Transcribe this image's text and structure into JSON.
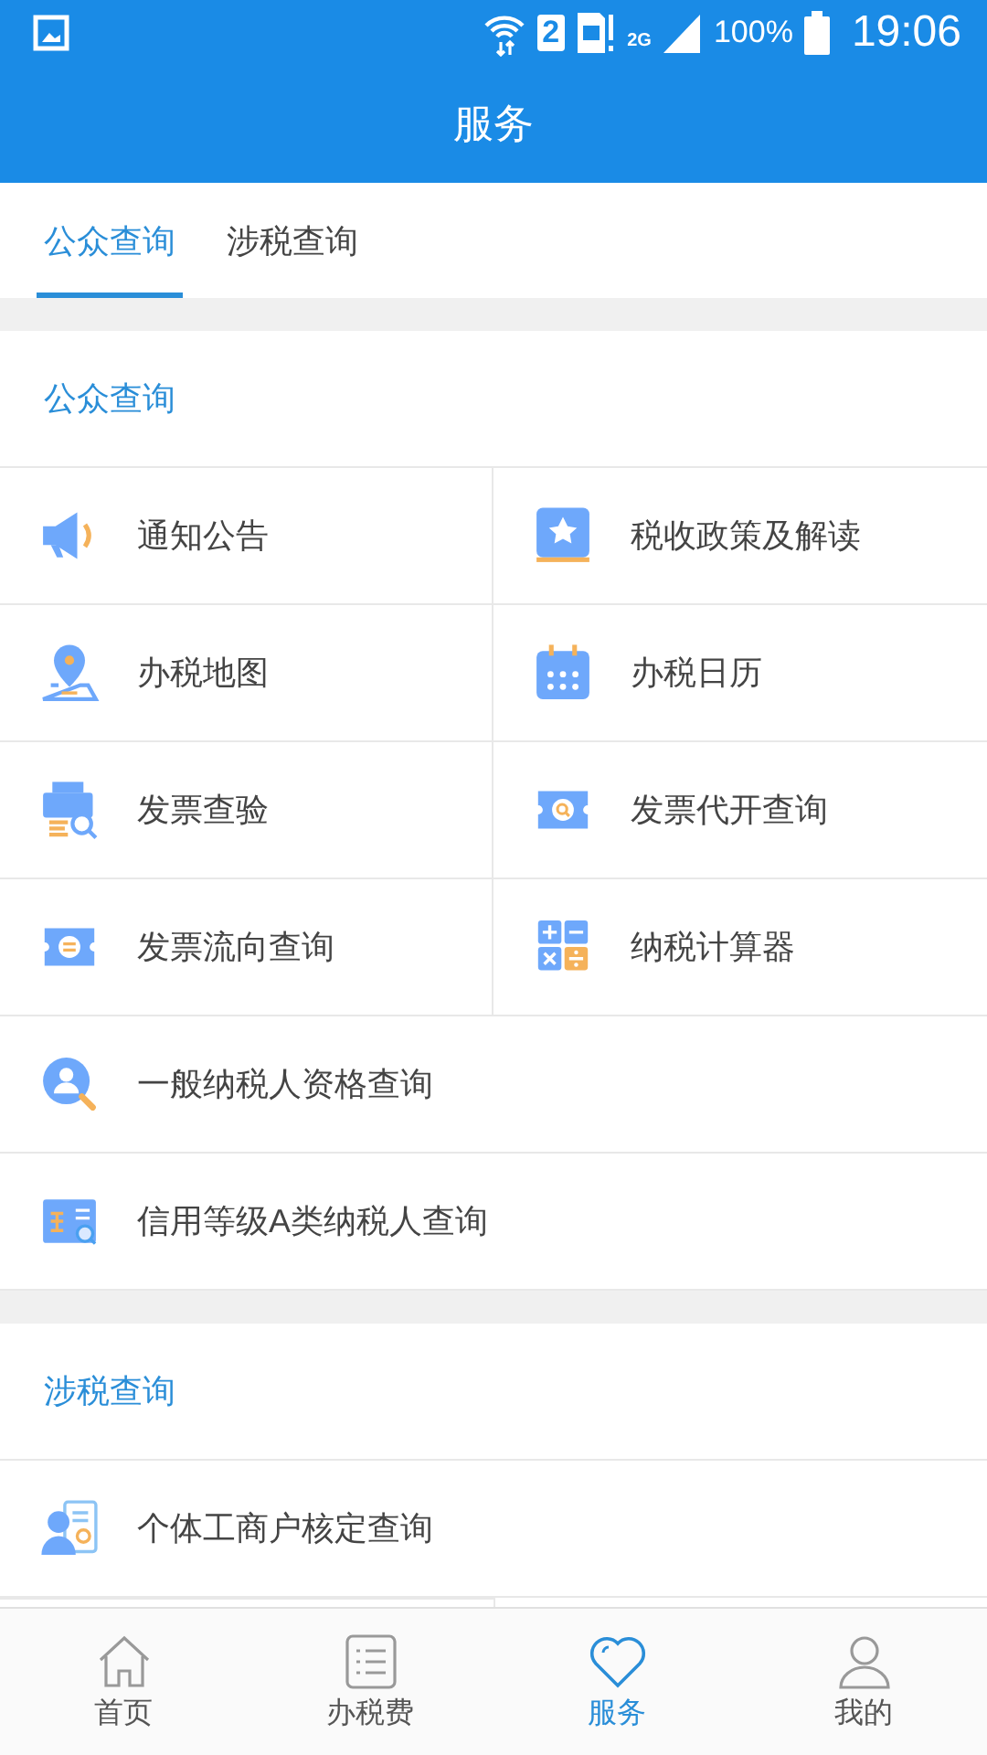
{
  "status_bar": {
    "sim": "2",
    "network": "2G",
    "battery": "100%",
    "time": "19:06"
  },
  "title": "服务",
  "tabs": [
    {
      "label": "公众查询",
      "selected": true
    },
    {
      "label": "涉税查询",
      "selected": false
    }
  ],
  "sections": [
    {
      "title": "公众查询",
      "items": [
        {
          "label": "通知公告",
          "kind": "half"
        },
        {
          "label": "税收政策及解读",
          "kind": "half"
        },
        {
          "label": "办税地图",
          "kind": "half"
        },
        {
          "label": "办税日历",
          "kind": "half"
        },
        {
          "label": "发票查验",
          "kind": "half"
        },
        {
          "label": "发票代开查询",
          "kind": "half"
        },
        {
          "label": "发票流向查询",
          "kind": "half"
        },
        {
          "label": "纳税计算器",
          "kind": "half"
        },
        {
          "label": "一般纳税人资格查询",
          "kind": "full"
        },
        {
          "label": "信用等级A类纳税人查询",
          "kind": "full"
        }
      ]
    },
    {
      "title": "涉税查询",
      "items": [
        {
          "label": "个体工商户核定查询",
          "kind": "full"
        }
      ]
    }
  ],
  "bottom_nav": [
    {
      "label": "首页",
      "selected": false
    },
    {
      "label": "办税费",
      "selected": false
    },
    {
      "label": "服务",
      "selected": true
    },
    {
      "label": "我的",
      "selected": false
    }
  ]
}
